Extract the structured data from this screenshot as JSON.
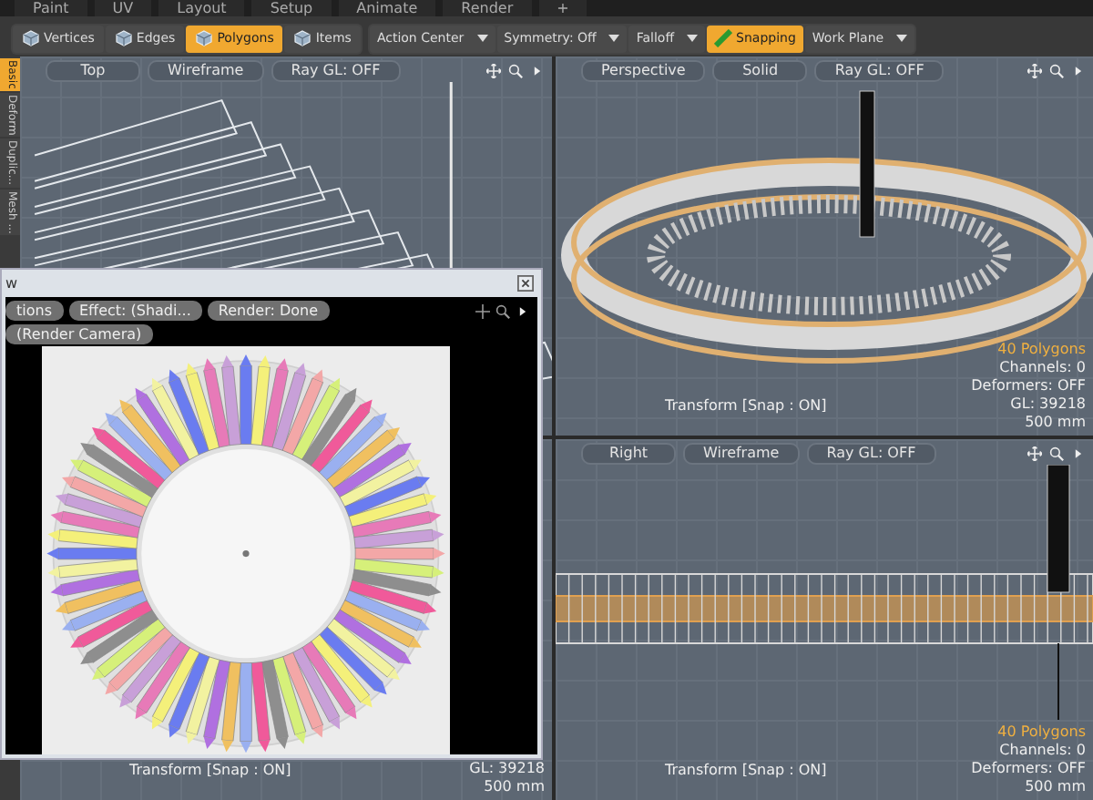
{
  "menu_tabs": [
    {
      "label": "Paint",
      "selected": false
    },
    {
      "label": "UV",
      "selected": false
    },
    {
      "label": "Layout",
      "selected": false
    },
    {
      "label": "Setup",
      "selected": false
    },
    {
      "label": "Animate",
      "selected": false
    },
    {
      "label": "Render",
      "selected": false
    },
    {
      "label": "+",
      "selected": false
    }
  ],
  "toolbar": {
    "modes": [
      {
        "label": "Vertices",
        "selected": false
      },
      {
        "label": "Edges",
        "selected": false
      },
      {
        "label": "Polygons",
        "selected": true
      },
      {
        "label": "Items",
        "selected": false
      }
    ],
    "menus": [
      {
        "kind": "dropdown",
        "label": "Action Center"
      },
      {
        "kind": "dropdown",
        "label": "Symmetry: Off"
      },
      {
        "kind": "dropdown",
        "label": "Falloff"
      },
      {
        "kind": "toggle",
        "label": "Snapping",
        "on": true
      },
      {
        "kind": "dropdown",
        "label": "Work Plane"
      }
    ]
  },
  "side_tabs": [
    {
      "label": "Basic",
      "selected": true
    },
    {
      "label": "Deform",
      "selected": false
    },
    {
      "label": "Duplic...",
      "selected": false
    },
    {
      "label": "Mesh ...",
      "selected": false
    }
  ],
  "viewports": [
    {
      "kind": "top",
      "view": "Top",
      "shading": "Wireframe",
      "ray": "Ray GL: OFF"
    },
    {
      "kind": "perspective",
      "view": "Perspective",
      "shading": "Solid",
      "ray": "Ray GL: OFF",
      "status": "Transform [Snap : ON]",
      "info": [
        {
          "text": "40 Polygons",
          "highlight": true
        },
        {
          "text": "Channels: 0",
          "highlight": false
        },
        {
          "text": "Deformers: OFF",
          "highlight": false
        },
        {
          "text": "GL: 39218",
          "highlight": false
        },
        {
          "text": "500 mm",
          "highlight": false
        }
      ]
    },
    {
      "kind": "hidden",
      "status": "Transform [Snap : ON]",
      "info": [
        {
          "text": "GL: 39218",
          "highlight": false
        },
        {
          "text": "500 mm",
          "highlight": false
        }
      ]
    },
    {
      "kind": "right",
      "view": "Right",
      "shading": "Wireframe",
      "ray": "Ray GL: OFF",
      "status": "Transform [Snap : ON]",
      "info": [
        {
          "text": "40 Polygons",
          "highlight": true
        },
        {
          "text": "Channels: 0",
          "highlight": false
        },
        {
          "text": "Deformers: OFF",
          "highlight": false
        },
        {
          "text": "500 mm",
          "highlight": false
        }
      ]
    }
  ],
  "preview": {
    "title": "w",
    "row_1": [
      "tions",
      "Effect: (Shadi...",
      "Render: Done"
    ],
    "row_2": [
      "(Render Camera)"
    ]
  }
}
